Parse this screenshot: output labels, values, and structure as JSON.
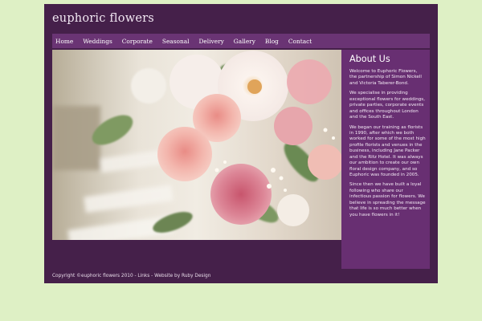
{
  "site": {
    "title": "euphoric flowers"
  },
  "nav": {
    "items": [
      "Home",
      "Weddings",
      "Corporate",
      "Seasonal",
      "Delivery",
      "Gallery",
      "Blog",
      "Contact"
    ]
  },
  "hero": {
    "description_icon": "flower-bouquet-photo"
  },
  "about": {
    "heading": "About Us",
    "paragraphs": [
      "Welcome to Euphoric Flowers, the partnership of Simon Nickell and Victoria Taberer-Bond.",
      "We specialise in providing exceptional flowers for weddings, private parties, corporate events and offices throughout London and the South East.",
      "We began our training as florists in 1990, after which we both worked for some of the most high profile florists and venues in the business, including Jane Packer and the Ritz Hotel. It was always our ambition to create our own floral design company, and so Euphoric was founded in 2005.",
      "Since then we have built a loyal following who share our infectious passion for flowers. We believe in spreading the message that life is so much better when you have flowers in it!"
    ]
  },
  "footer": {
    "text": "Copyright ©euphoric flowers 2010 - Links - Website by Ruby Design"
  },
  "colors": {
    "background": "#def0c5",
    "page": "#45204a",
    "nav": "#6a3474",
    "sidebar": "#682f72"
  }
}
